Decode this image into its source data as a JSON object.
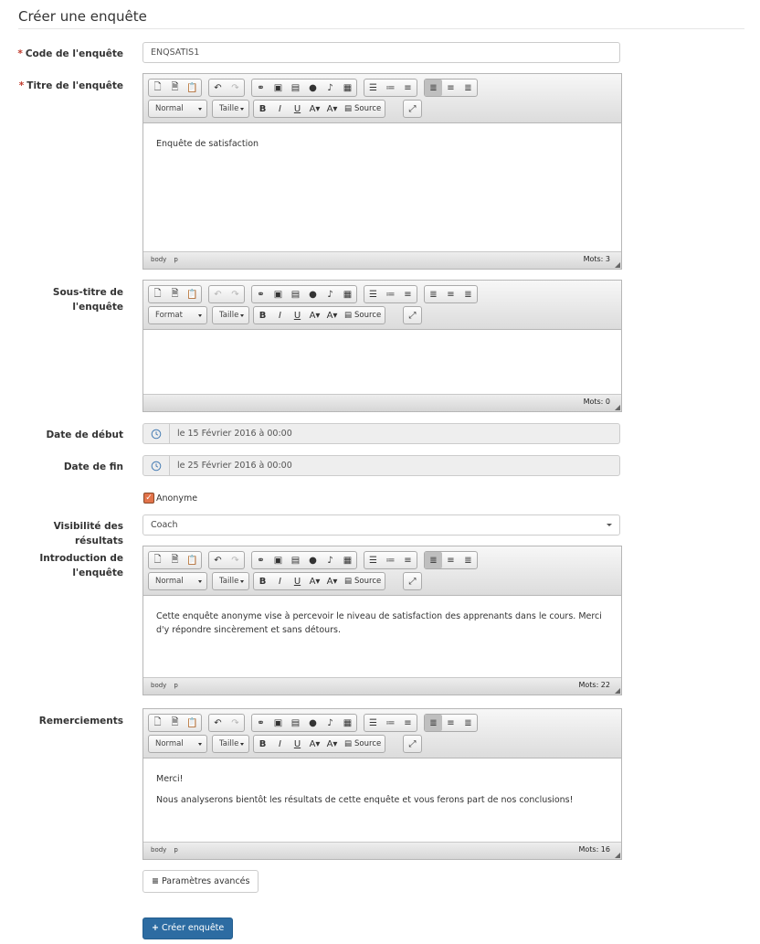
{
  "page": {
    "title": "Créer une enquête"
  },
  "form": {
    "code": {
      "label": "Code de l'enquête",
      "required": "*",
      "value": "ENQSATIS1"
    },
    "title": {
      "label": "Titre de l'enquête",
      "required": "*"
    },
    "subtitle": {
      "label": "Sous-titre de l'enquête"
    },
    "start_date": {
      "label": "Date de début",
      "value": "le 15 Février 2016 à 00:00"
    },
    "end_date": {
      "label": "Date de fin",
      "value": "le 25 Février 2016 à 00:00"
    },
    "anonymous": {
      "label": "Anonyme",
      "checked": true
    },
    "visibility": {
      "label": "Visibilité des résultats",
      "value": "Coach"
    },
    "intro": {
      "label_line1": "Introduction de",
      "label_line2": "l'enquête"
    },
    "thanks": {
      "label": "Remerciements"
    }
  },
  "editors": {
    "title": {
      "format": "Normal",
      "size": "Taille",
      "source": "Source",
      "paragraphs": [
        "Enquête de satisfaction"
      ],
      "path": [
        "body",
        "p"
      ],
      "wordcount": "Mots: 3"
    },
    "subtitle": {
      "format": "Format",
      "size": "Taille",
      "source": "Source",
      "paragraphs": [],
      "path": [],
      "wordcount": "Mots: 0"
    },
    "intro": {
      "format": "Normal",
      "size": "Taille",
      "source": "Source",
      "paragraphs": [
        "Cette enquête anonyme vise à percevoir le niveau de satisfaction des apprenants dans le cours. Merci d'y répondre sincèrement et sans détours."
      ],
      "path": [
        "body",
        "p"
      ],
      "wordcount": "Mots: 22"
    },
    "thanks": {
      "format": "Normal",
      "size": "Taille",
      "source": "Source",
      "paragraphs": [
        "Merci!",
        "Nous analyserons bientôt les résultats de cette enquête et vous ferons part de nos conclusions!"
      ],
      "path": [
        "body",
        "p"
      ],
      "wordcount": "Mots: 16"
    }
  },
  "buttons": {
    "advanced": "Paramètres avancés",
    "create": "Créer enquête"
  },
  "icons": {
    "toolbar": [
      "new-page-icon",
      "paste-text-icon",
      "paste-word-icon",
      "undo-icon",
      "redo-icon",
      "link-icon",
      "image-icon",
      "video-icon",
      "flash-icon",
      "audio-icon",
      "table-icon",
      "bulleted-list-icon",
      "numbered-list-icon",
      "horizontal-rule-icon",
      "align-left-icon",
      "align-center-icon",
      "justify-icon",
      "bold-icon",
      "italic-icon",
      "underline-icon",
      "text-color-icon",
      "background-color-icon",
      "source-icon",
      "maximize-icon"
    ],
    "clock": "clock-icon"
  },
  "colors": {
    "required": "#c0392b",
    "primary_button": "#2d6ca2",
    "checkbox": "#e2734a"
  }
}
